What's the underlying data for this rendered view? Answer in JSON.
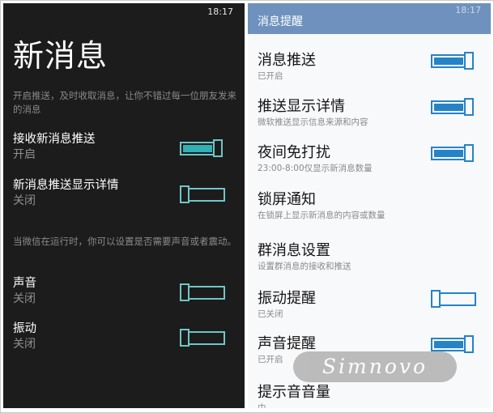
{
  "left": {
    "time": "18:17",
    "title": "新消息",
    "description": "开启推送，及时收取消息，让你不错过每一位朋友发来的消息",
    "rows_top": [
      {
        "label": "接收新消息推送",
        "state": "开启",
        "on": true
      },
      {
        "label": "新消息推送显示详情",
        "state": "关闭",
        "on": false
      }
    ],
    "sound_description": "当微信在运行时，你可以设置是否需要声音或者震动。",
    "rows_bottom": [
      {
        "label": "声音",
        "state": "关闭",
        "on": false
      },
      {
        "label": "振动",
        "state": "关闭",
        "on": false
      }
    ]
  },
  "right": {
    "header_title": "消息提醒",
    "time": "18:17",
    "items": [
      {
        "label": "消息推送",
        "sub": "已开启",
        "toggle": "on"
      },
      {
        "label": "推送显示详情",
        "sub": "微软推送显示信息来源和内容",
        "toggle": "on"
      },
      {
        "label": "夜间免打扰",
        "sub": "23:00-8:00仅显示新消息数量",
        "toggle": "on"
      },
      {
        "label": "锁屏通知",
        "sub": "在锁屏上显示新消息的内容或数量",
        "toggle": "none"
      },
      {
        "label": "群消息设置",
        "sub": "设置群消息的接收和推送",
        "toggle": "none"
      },
      {
        "label": "振动提醒",
        "sub": "已关闭",
        "toggle": "off"
      },
      {
        "label": "声音提醒",
        "sub": "已开启",
        "toggle": "on"
      },
      {
        "label": "提示音音量",
        "sub": "中",
        "toggle": "none"
      }
    ]
  },
  "watermark": "Simnovo",
  "colors": {
    "dark_bg": "#1c1c1c",
    "dark_accent": "#2fb1b5",
    "light_header": "#6e92bd",
    "light_accent": "#2583c8"
  }
}
